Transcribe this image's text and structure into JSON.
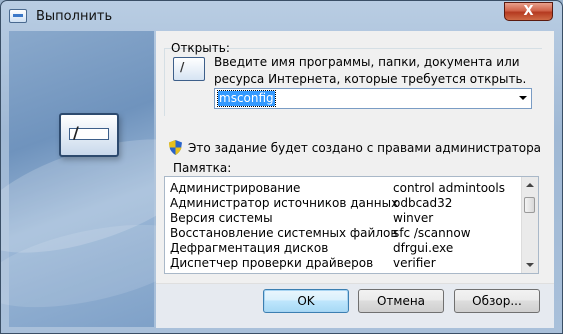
{
  "window": {
    "title": "Выполнить",
    "close_label": "X"
  },
  "open_label": "Открыть:",
  "description": "Введите имя программы, папки, документа или ресурса Интернета, которые требуется открыть.",
  "combo": {
    "value": "msconfig"
  },
  "admin_note": "Это задание будет создано с правами администратора",
  "memo_label": "Памятка:",
  "list": [
    {
      "name": "Администрирование",
      "cmd": "control admintools"
    },
    {
      "name": "Администратор источников данных",
      "cmd": "odbcad32"
    },
    {
      "name": "Версия системы",
      "cmd": "winver"
    },
    {
      "name": "Восстановление системных файлов",
      "cmd": "sfc /scannow"
    },
    {
      "name": "Дефрагментация дисков",
      "cmd": "dfrgui.exe"
    },
    {
      "name": "Диспетчер проверки драйверов",
      "cmd": "verifier"
    }
  ],
  "buttons": {
    "ok": "OK",
    "cancel": "Отмена",
    "browse": "Обзор..."
  },
  "icons": {
    "app": "run-dialog-icon",
    "shield": "uac-shield-icon",
    "big": "run-command-icon"
  }
}
